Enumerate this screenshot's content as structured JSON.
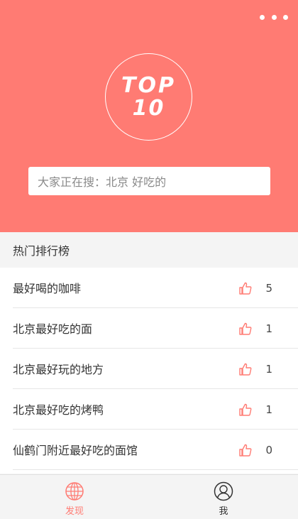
{
  "header": {
    "logo_line1": "TOP",
    "logo_line2": "10",
    "menu_icon": "ellipsis-icon"
  },
  "search": {
    "placeholder": "大家正在搜：北京  好吃的"
  },
  "section": {
    "title": "热门排行榜"
  },
  "list": {
    "items": [
      {
        "title": "最好喝的咖啡",
        "count": "5"
      },
      {
        "title": "北京最好吃的面",
        "count": "1"
      },
      {
        "title": "北京最好玩的地方",
        "count": "1"
      },
      {
        "title": "北京最好吃的烤鸭",
        "count": "1"
      },
      {
        "title": "仙鹤门附近最好吃的面馆",
        "count": "0"
      }
    ],
    "like_icon": "thumbs-up-icon"
  },
  "tabbar": {
    "tabs": [
      {
        "label": "发现",
        "icon": "globe-icon",
        "active": true
      },
      {
        "label": "我",
        "icon": "user-icon",
        "active": false
      }
    ]
  },
  "colors": {
    "accent": "#ff7b73",
    "background": "#f4f4f4"
  }
}
